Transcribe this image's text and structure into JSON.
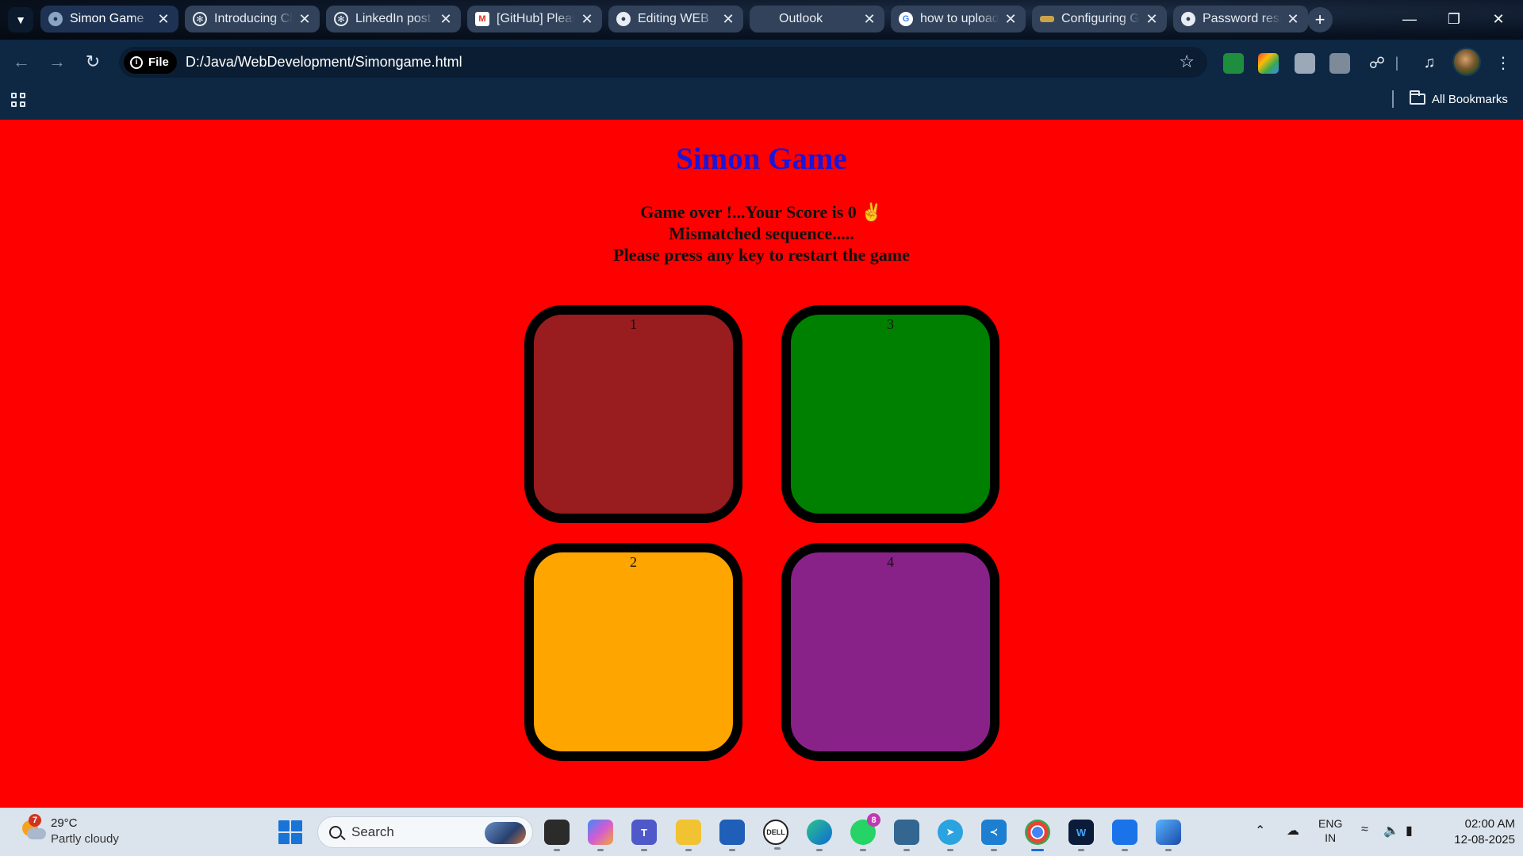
{
  "browser": {
    "tabs": [
      {
        "label": "Simon Game",
        "active": true,
        "favicon": "globe-icon"
      },
      {
        "label": "Introducing ChatGPT",
        "favicon": "openai-icon"
      },
      {
        "label": "LinkedIn post",
        "favicon": "openai-icon"
      },
      {
        "label": "[GitHub] Please",
        "favicon": "gmail-icon"
      },
      {
        "label": "Editing WEB",
        "favicon": "github-icon"
      },
      {
        "label": "Outlook",
        "favicon": "outlook-icon"
      },
      {
        "label": "how to upload",
        "favicon": "google-icon"
      },
      {
        "label": "Configuring Git",
        "favicon": "git-icon"
      },
      {
        "label": "Password reset",
        "favicon": "github-icon"
      }
    ],
    "new_tab_label": "+",
    "address": {
      "scheme_chip": "File",
      "url": "D:/Java/WebDevelopment/Simongame.html"
    },
    "bookmarks": {
      "all_bookmarks_label": "All Bookmarks"
    }
  },
  "page": {
    "title": "Simon Game",
    "status_lines": [
      "Game over !...Your Score is 0 ✌️",
      "Mismatched sequence.....",
      "Please press any key to restart the game"
    ],
    "pads": [
      {
        "label": "1",
        "color": "#991c1e"
      },
      {
        "label": "3",
        "color": "#008000"
      },
      {
        "label": "2",
        "color": "#ffa500"
      },
      {
        "label": "4",
        "color": "#882288"
      }
    ],
    "background": "#ff0000",
    "title_color": "#1a16d9"
  },
  "taskbar": {
    "weather": {
      "temp": "29°C",
      "condition": "Partly cloudy",
      "badge": "7"
    },
    "search_placeholder": "Search",
    "whatsapp_badge": "8",
    "tray": {
      "lang": "ENG",
      "region": "IN"
    },
    "clock": {
      "time": "02:00 AM",
      "date": "12-08-2025"
    }
  }
}
